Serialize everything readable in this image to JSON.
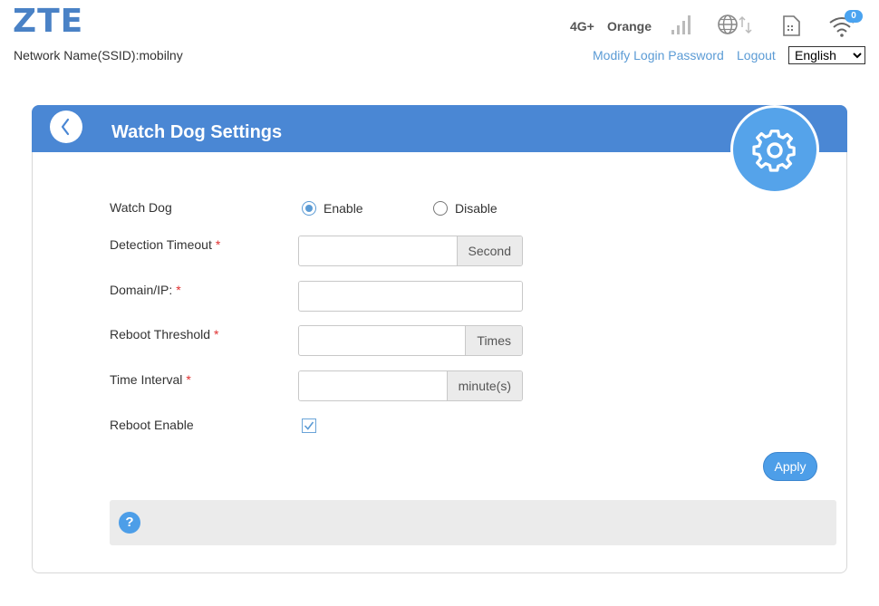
{
  "brand": {
    "logo": "ZTE"
  },
  "header": {
    "ssid_text": "Network Name(SSID):mobilny",
    "network_type": "4G+",
    "operator": "Orange",
    "wifi_clients": "0",
    "links": {
      "modify_password": "Modify Login Password",
      "logout": "Logout"
    },
    "language": {
      "selected": "English"
    }
  },
  "icons": {
    "signal": "signal-bars-icon",
    "globe": "globe-data-icon",
    "sim": "sim-card-icon",
    "wifi": "wifi-icon",
    "back": "chevron-left-icon",
    "gear": "gear-icon",
    "help": "help-icon",
    "check": "check-icon"
  },
  "colors": {
    "accent": "#4a87d4",
    "link": "#5b9bd5",
    "required": "#e03030"
  },
  "page": {
    "title": "Watch Dog Settings",
    "form": {
      "watch_dog": {
        "label": "Watch Dog",
        "enable": "Enable",
        "disable": "Disable",
        "selected": "Enable"
      },
      "detection_timeout": {
        "label": "Detection Timeout",
        "required": "*",
        "value": "",
        "unit": "Second"
      },
      "domain_ip": {
        "label": "Domain/IP:",
        "required": "*",
        "value": ""
      },
      "reboot_threshold": {
        "label": "Reboot Threshold",
        "required": "*",
        "value": "",
        "unit": "Times"
      },
      "time_interval": {
        "label": "Time Interval",
        "required": "*",
        "value": "",
        "unit": "minute(s)"
      },
      "reboot_enable": {
        "label": "Reboot Enable",
        "checked": true
      }
    },
    "apply_label": "Apply",
    "help_symbol": "?"
  }
}
